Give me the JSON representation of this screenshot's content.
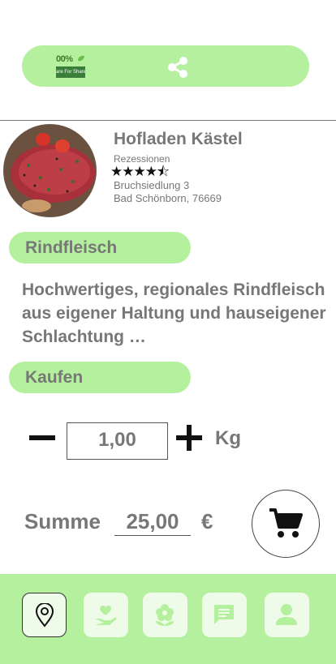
{
  "header": {
    "logo_text": "00%",
    "logo_subtext": "are For Share",
    "share_icon": "share-icon"
  },
  "shop": {
    "name": "Hofladen Kästel",
    "reviews_label": "Rezessionen",
    "rating": 4.5,
    "rating_stars": "★★★★⯪",
    "address_line1": "Bruchsiedlung 3",
    "address_line2": "Bad Schönborn, 76669"
  },
  "product": {
    "title": "Rindfleisch",
    "description": "Hochwertiges, regionales Rindfleisch aus eigener Haltung und hauseigener Schlachtung …"
  },
  "purchase": {
    "section_title": "Kaufen",
    "quantity": "1,00",
    "unit": "Kg",
    "sum_label": "Summe",
    "sum_value": "25,00",
    "currency": "€"
  },
  "nav": {
    "items": [
      "location-pin-icon",
      "hand-heart-icon",
      "flower-icon",
      "chat-icon",
      "user-icon"
    ]
  },
  "colors": {
    "accent": "#b4f09e",
    "text": "#777777",
    "nav_button": "#effbe9"
  }
}
